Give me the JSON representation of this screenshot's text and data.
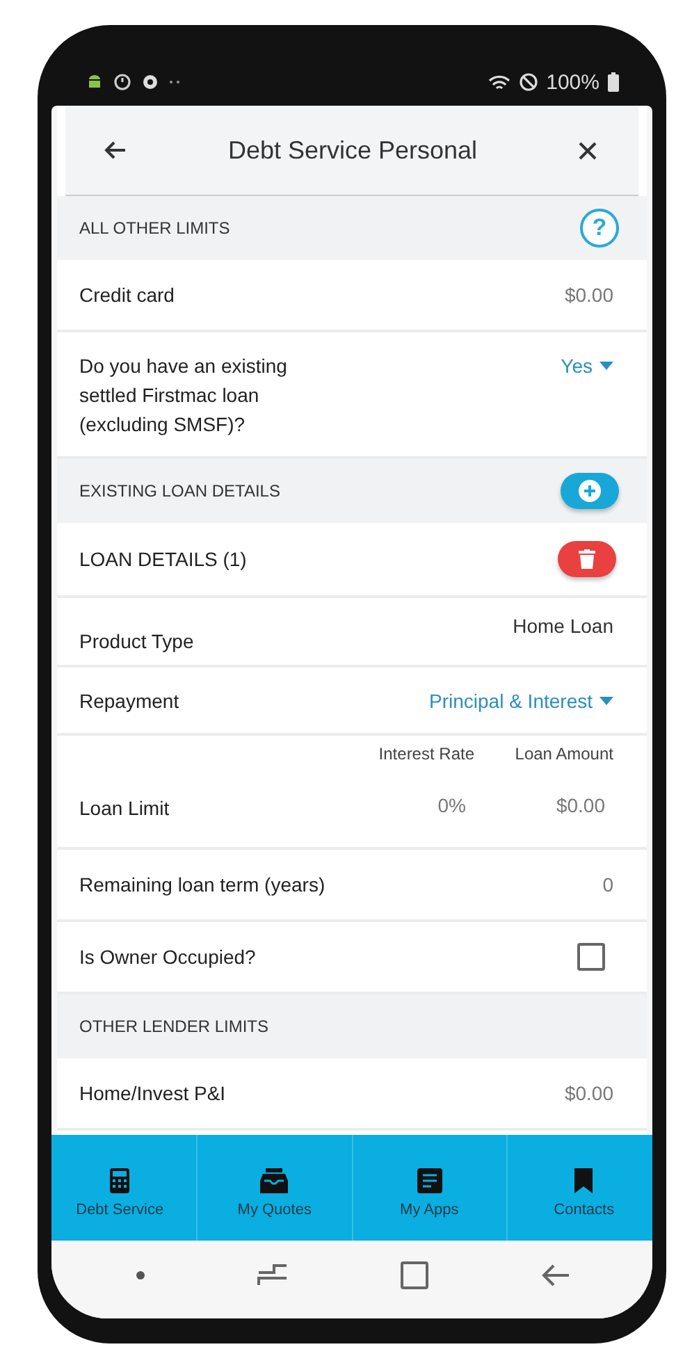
{
  "status_bar": {
    "battery": "100%"
  },
  "header": {
    "title": "Debt Service Personal"
  },
  "sections": [
    {
      "title": "ALL OTHER LIMITS",
      "help": "?",
      "rows": [
        {
          "kind": "value",
          "label": "Credit card",
          "value": "$0.00"
        },
        {
          "kind": "dropdown",
          "label": "Do you have an existing settled Firstmac loan (excluding SMSF)?",
          "value": "Yes"
        }
      ]
    },
    {
      "title": "EXISTING LOAN DETAILS",
      "add": true,
      "rows": [
        {
          "kind": "subheader",
          "label": "LOAN DETAILS (1)"
        },
        {
          "kind": "text",
          "label": "Product Type",
          "value": "Home Loan"
        },
        {
          "kind": "dropdown",
          "label": "Repayment",
          "value": "Principal & Interest"
        },
        {
          "kind": "split",
          "label": "Loan Limit",
          "columns": [
            {
              "heading": "Interest Rate",
              "value": "0%"
            },
            {
              "heading": "Loan Amount",
              "value": "$0.00"
            }
          ]
        },
        {
          "kind": "value",
          "label": "Remaining loan term (years)",
          "value": "0"
        },
        {
          "kind": "checkbox",
          "label": "Is Owner Occupied?",
          "checked": false
        }
      ]
    },
    {
      "title": "OTHER LENDER LIMITS",
      "rows": [
        {
          "kind": "value",
          "label": "Home/Invest P&I",
          "value": "$0.00"
        }
      ]
    }
  ],
  "bottom_nav": [
    {
      "label": "Debt Service"
    },
    {
      "label": "My Quotes"
    },
    {
      "label": "My Apps"
    },
    {
      "label": "Contacts"
    }
  ]
}
